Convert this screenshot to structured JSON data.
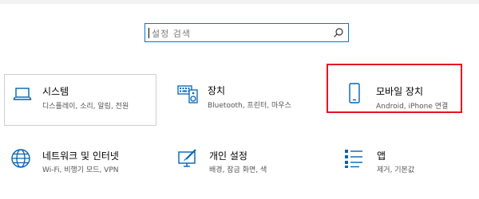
{
  "search": {
    "placeholder": "설정 검색",
    "icon": "search-icon"
  },
  "tiles": [
    {
      "title": "시스템",
      "desc": "디스플레이, 소리, 알림, 전원",
      "icon": "laptop-icon"
    },
    {
      "title": "장치",
      "desc": "Bluetooth, 프린터, 마우스",
      "icon": "keyboard-speaker-icon"
    },
    {
      "title": "모바일 장치",
      "desc": "Android, iPhone 연결",
      "icon": "phone-icon",
      "highlighted": true
    },
    {
      "title": "네트워크 및 인터넷",
      "desc": "Wi-Fi, 비행기 모드, VPN",
      "icon": "globe-icon"
    },
    {
      "title": "개인 설정",
      "desc": "배경, 잠금 화면, 색",
      "icon": "paint-monitor-icon"
    },
    {
      "title": "앱",
      "desc": "제거, 기본값",
      "icon": "apps-list-icon"
    }
  ],
  "colors": {
    "accent": "#0078d7",
    "highlight": "#e81123",
    "desc_text": "#555555",
    "tile_border": "#cfcfcf"
  }
}
